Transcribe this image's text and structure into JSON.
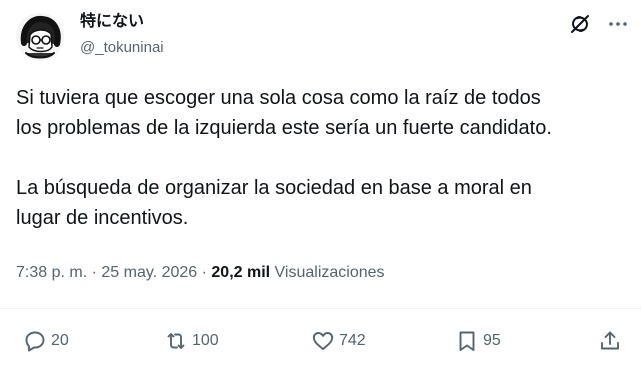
{
  "author": {
    "display_name": "特にない",
    "handle": "@_tokuninai",
    "avatar_icon": "anime-avatar-icon"
  },
  "header_icons": [
    "grok-icon",
    "more-icon"
  ],
  "tweet": {
    "lines": [
      "Si tuviera que escoger una sola cosa como la raíz de todos",
      "los problemas de la izquierda este sería un fuerte candidato.",
      "",
      "La búsqueda de organizar la sociedad en base a moral en",
      "lugar de incentivos."
    ]
  },
  "meta": {
    "time": "7:38 p. m.",
    "date": "25 may. 2026",
    "views_count": "20,2 mil",
    "views_label": "Visualizaciones"
  },
  "actions": {
    "replies": "20",
    "reposts": "100",
    "likes": "742",
    "bookmarks": "95"
  },
  "colors": {
    "text": "#0f1419",
    "secondary": "#536471",
    "divider": "#eff3f4"
  }
}
